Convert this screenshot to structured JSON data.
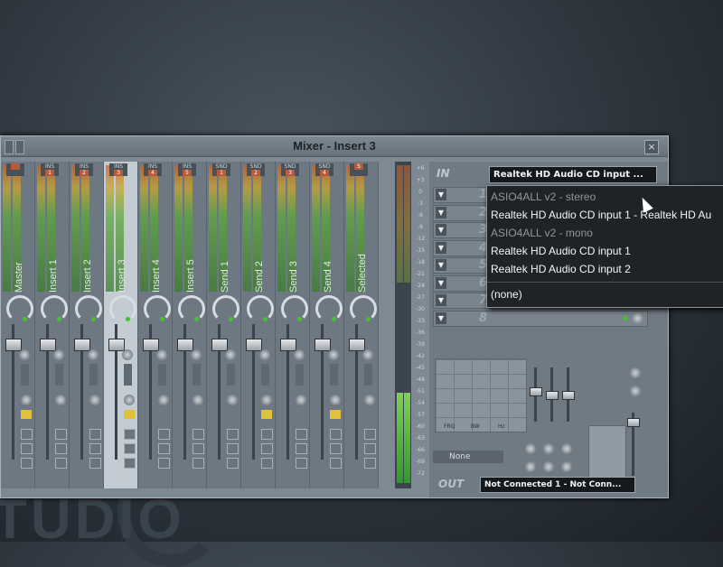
{
  "window": {
    "title": "Mixer - Insert 3",
    "close_glyph": "×"
  },
  "strips": [
    {
      "label": "Master",
      "tag_top": "",
      "tag_num": ""
    },
    {
      "label": "Insert 1",
      "tag_top": "INS",
      "tag_num": "1"
    },
    {
      "label": "Insert 2",
      "tag_top": "INS",
      "tag_num": "2"
    },
    {
      "label": "Insert 3",
      "tag_top": "INS",
      "tag_num": "3"
    },
    {
      "label": "Insert 4",
      "tag_top": "INS",
      "tag_num": "4"
    },
    {
      "label": "Insert 5",
      "tag_top": "INS",
      "tag_num": "5"
    },
    {
      "label": "Send 1",
      "tag_top": "SND",
      "tag_num": "1"
    },
    {
      "label": "Send 2",
      "tag_top": "SND",
      "tag_num": "2"
    },
    {
      "label": "Send 3",
      "tag_top": "SND",
      "tag_num": "3"
    },
    {
      "label": "Send 4",
      "tag_top": "SND",
      "tag_num": "4"
    },
    {
      "label": "Selected",
      "tag_top": "",
      "tag_num": "S"
    }
  ],
  "scale_ticks": [
    "+6",
    "+3",
    "0",
    "-3",
    "-6",
    "-9",
    "-12",
    "-15",
    "-18",
    "-21",
    "-24",
    "-27",
    "-30",
    "-33",
    "-36",
    "-39",
    "-42",
    "-45",
    "-48",
    "-51",
    "-54",
    "-57",
    "-60",
    "-63",
    "-66",
    "-69",
    "-72"
  ],
  "fx_panel": {
    "in_label": "IN",
    "input_selected": "Realtek HD Audio CD input ...",
    "slot_numbers": [
      "1",
      "2",
      "3",
      "4",
      "5",
      "6",
      "7",
      "8"
    ],
    "arrow_glyph": "▼",
    "eq_labels": [
      "FRQ",
      "BW",
      "Hz"
    ],
    "output_label": "OUT",
    "output_selected": "Not Connected 1 - Not Conn...",
    "none_label": "None"
  },
  "input_menu": {
    "items": [
      {
        "text": "ASIO4ALL v2 - stereo",
        "header": true
      },
      {
        "text": "Realtek HD Audio CD input 1 - Realtek HD Au",
        "header": false
      },
      {
        "text": "ASIO4ALL v2 - mono",
        "header": true
      },
      {
        "text": "Realtek HD Audio CD input 1",
        "header": false
      },
      {
        "text": "Realtek HD Audio CD input 2",
        "header": false
      },
      {
        "text": "(none)",
        "header": false
      }
    ]
  },
  "background": {
    "brand_text": "TUDIO"
  },
  "colors": {
    "meter_green": "#3ec52c",
    "insert_tag": "#b85b3c",
    "selected_strip": "#c4ccd3",
    "menu_bg": "#1f2326"
  }
}
